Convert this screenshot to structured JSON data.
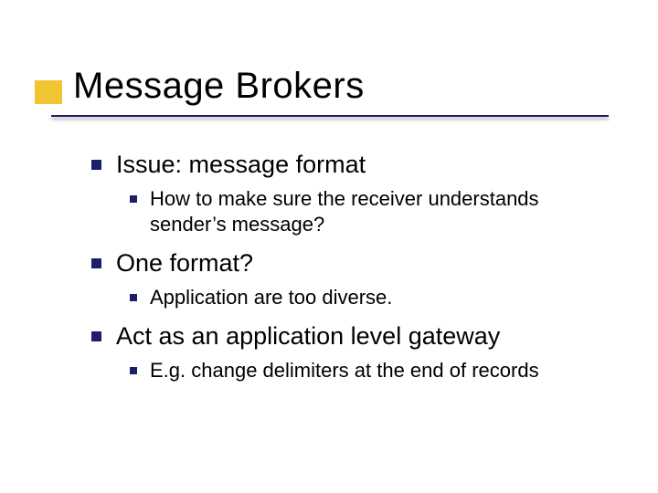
{
  "title": "Message Brokers",
  "bullets": [
    {
      "text": "Issue: message format",
      "sub": [
        "How to make sure the receiver understands sender’s message?"
      ]
    },
    {
      "text": "One format?",
      "sub": [
        "Application are too diverse."
      ]
    },
    {
      "text": "Act as an application level gateway",
      "sub": [
        "E.g. change delimiters at the end of records"
      ]
    }
  ],
  "colors": {
    "accent_yellow": "#f1c433",
    "accent_navy": "#1b1f6a"
  }
}
